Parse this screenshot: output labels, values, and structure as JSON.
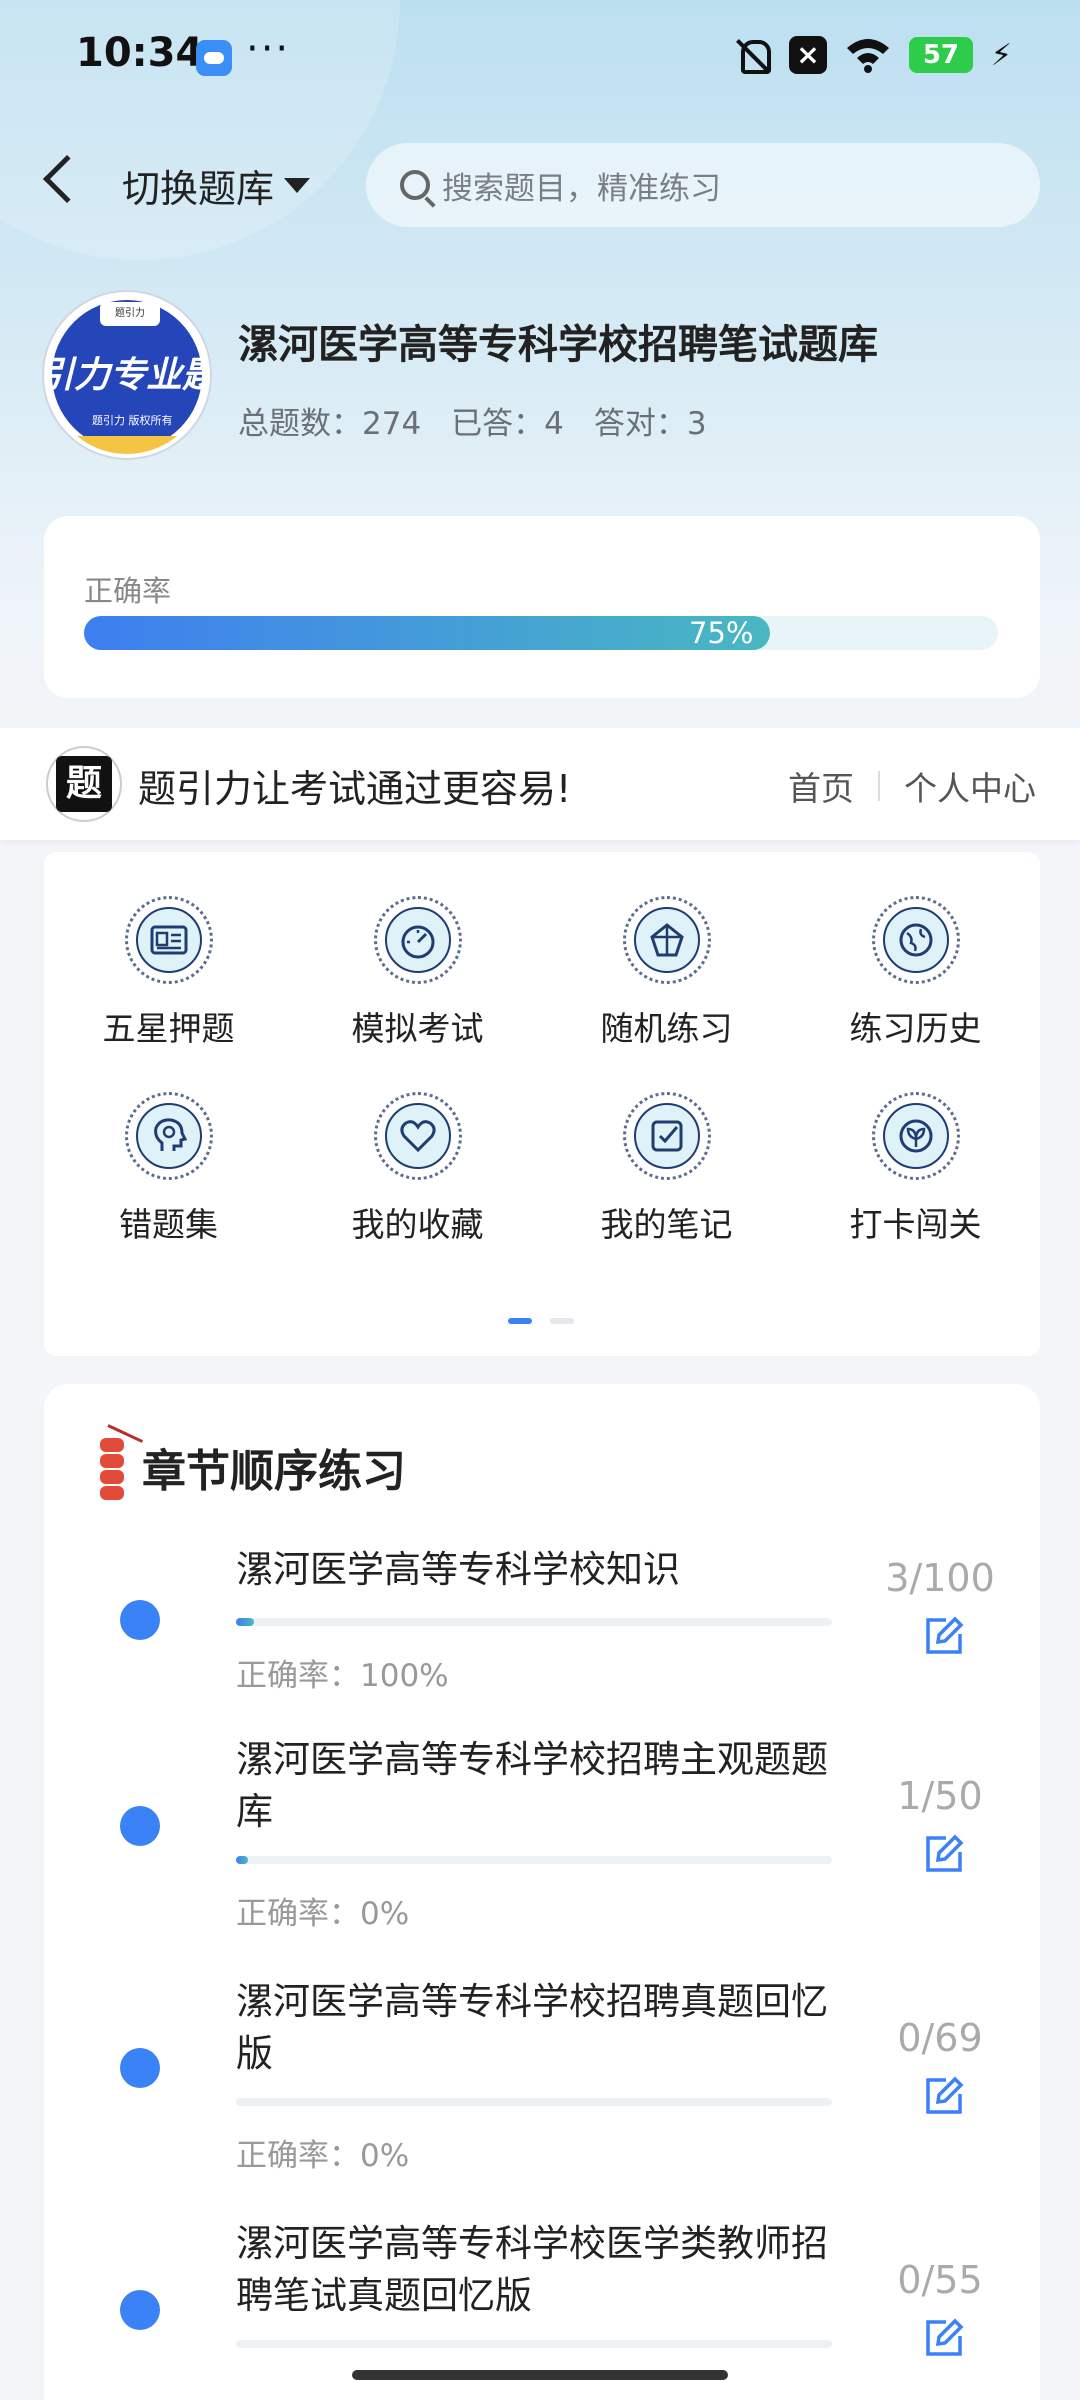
{
  "status": {
    "time": "10:34",
    "dots": "···",
    "battery": "57"
  },
  "header": {
    "switch_label": "切换题库",
    "search_placeholder": "搜索题目，精准练习"
  },
  "bank": {
    "title": "漯河医学高等专科学校招聘笔试题库",
    "logo_text": "引力专业题",
    "logo_subtext": "题引力 版权所有",
    "total": "总题数：274",
    "answered": "已答：4",
    "correct": "答对：3"
  },
  "accuracy": {
    "label": "正确率",
    "value_text": "75%",
    "percent": 75
  },
  "brand": {
    "slogan": "题引力让考试通过更容易!",
    "home": "首页",
    "profile": "个人中心"
  },
  "features": [
    {
      "label": "五星押题",
      "icon": "id-card-icon"
    },
    {
      "label": "模拟考试",
      "icon": "gauge-icon"
    },
    {
      "label": "随机练习",
      "icon": "shuffle-icon"
    },
    {
      "label": "练习历史",
      "icon": "globe-icon"
    },
    {
      "label": "错题集",
      "icon": "head-icon"
    },
    {
      "label": "我的收藏",
      "icon": "heart-icon"
    },
    {
      "label": "我的笔记",
      "icon": "note-check-icon"
    },
    {
      "label": "打卡闯关",
      "icon": "leaf-icon"
    }
  ],
  "chapters": {
    "title": "章节顺序练习",
    "items": [
      {
        "name": "漯河医学高等专科学校知识",
        "accuracy": "正确率：100%",
        "count": "3/100",
        "progress": 0.03
      },
      {
        "name": "漯河医学高等专科学校招聘主观题题库",
        "accuracy": "正确率：0%",
        "count": "1/50",
        "progress": 0.02
      },
      {
        "name": "漯河医学高等专科学校招聘真题回忆版",
        "accuracy": "正确率：0%",
        "count": "0/69",
        "progress": 0
      },
      {
        "name": "漯河医学高等专科学校医学类教师招聘笔试真题回忆版",
        "accuracy": "",
        "count": "0/55",
        "progress": 0
      }
    ]
  },
  "colors": {
    "accent": "#3b82f6",
    "teal": "#49b8c2"
  }
}
